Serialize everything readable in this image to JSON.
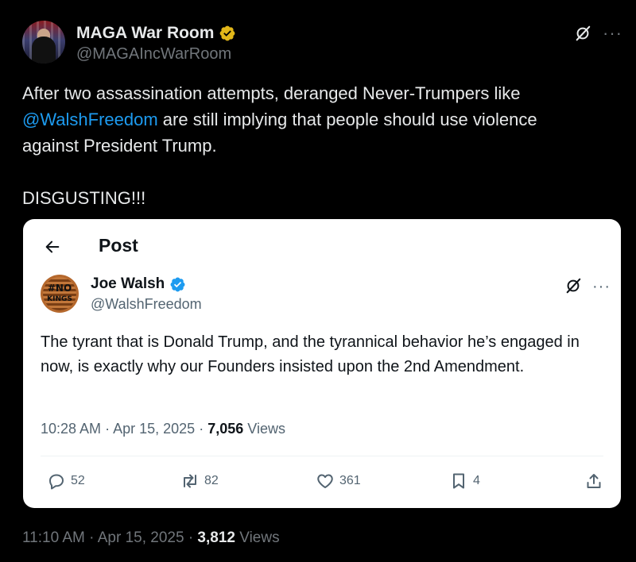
{
  "outer": {
    "name": "MAGA War Room",
    "handle": "@MAGAIncWarRoom",
    "text_line1": "After two assassination attempts, deranged Never-Trumpers like",
    "mention": "@WalshFreedom",
    "text_line2_rest": " are still implying that people should use violence",
    "text_line3": "against President Trump.",
    "text_line4": "DISGUSTING!!!",
    "time": "11:10 AM",
    "date": "Apr 15, 2025",
    "views_count": "3,812",
    "views_label": "Views",
    "sep": "·",
    "more": "···"
  },
  "quoted": {
    "header_title": "Post",
    "name": "Joe Walsh",
    "handle": "@WalshFreedom",
    "avatar_text_1": "#NO",
    "avatar_text_2": "KINGS",
    "text": "The tyrant that is Donald Trump, and the tyrannical behavior he’s engaged in now, is exactly why our Founders insisted upon the 2nd Amendment.",
    "time": "10:28 AM",
    "date": "Apr 15, 2025",
    "views_count": "7,056",
    "views_label": "Views",
    "sep": "·",
    "more": "···",
    "actions": {
      "replies": "52",
      "reposts": "82",
      "likes": "361",
      "bookmarks": "4"
    }
  },
  "colors": {
    "background": "#000000",
    "link": "#1d9bf0",
    "verified_gold": "#e2b719",
    "verified_blue": "#1d9bf0"
  }
}
